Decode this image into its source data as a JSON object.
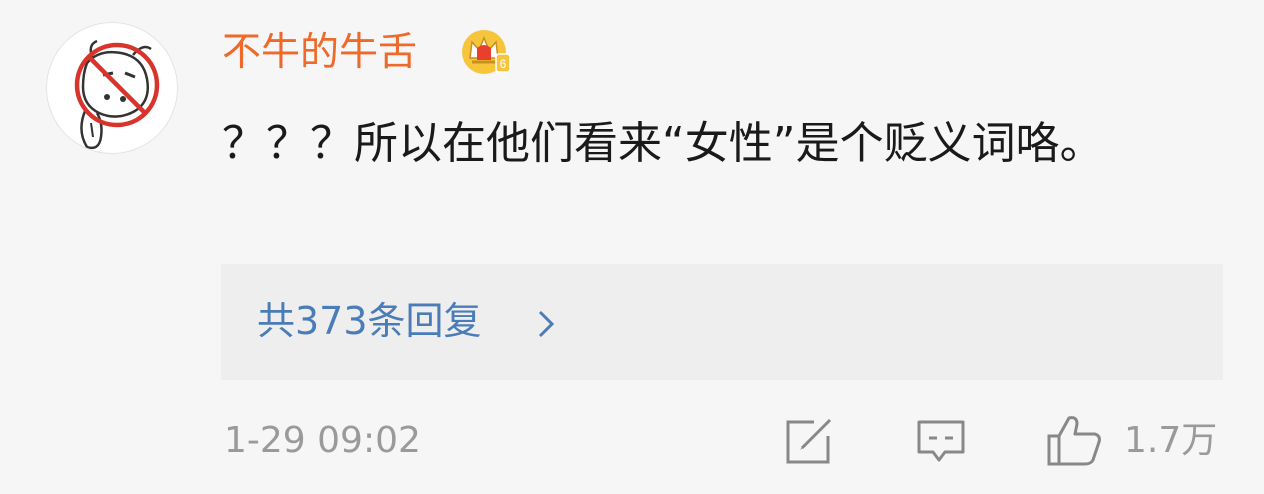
{
  "comment": {
    "username": "不牛的牛舌",
    "vip_badge_icon": "crown-vip-badge-icon",
    "text": "？？？所以在他们看来“女性”是个贬义词咯。",
    "replies_label": "共373条回复",
    "timestamp": "1-29 09:02",
    "like_count": "1.7万"
  },
  "icons": {
    "avatar": "crossed-out-cow-avatar",
    "reply_chevron": "chevron-right-icon",
    "share": "share-edit-icon",
    "comment": "comment-bubble-icon",
    "like": "thumbs-up-icon"
  },
  "colors": {
    "username": "#ee6a2a",
    "reply_link": "#4a7cb7",
    "meta_text": "#9a9a9a",
    "reply_box_bg": "#eeeeee",
    "page_bg": "#f6f6f6"
  }
}
